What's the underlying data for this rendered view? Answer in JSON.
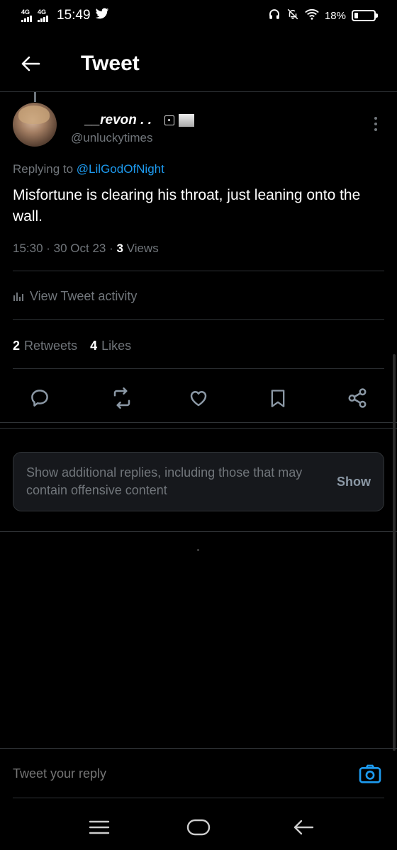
{
  "status_bar": {
    "network_1": "4G",
    "network_2": "4G",
    "time": "15:49",
    "battery_percent": "18%",
    "battery_level": 0.18,
    "icons": [
      "twitter-bird-icon",
      "headphones-icon",
      "mute-icon",
      "wifi-icon",
      "battery-icon"
    ]
  },
  "header": {
    "title": "Tweet",
    "back_icon": "arrow-left-icon"
  },
  "tweet": {
    "display_name": "__revon . .",
    "handle": "@unluckytimes",
    "replying_prefix": "Replying to",
    "replying_to": "@LilGodOfNight",
    "text": "Misfortune is clearing his throat, just leaning onto the wall.",
    "timestamp": "15:30 · 30 Oct 23 · ",
    "views_count": "3",
    "views_label": " Views",
    "activity_label": "View Tweet activity",
    "retweets_count": "2",
    "retweets_label": "Retweets",
    "likes_count": "4",
    "likes_label": "Likes"
  },
  "actions": [
    "reply-icon",
    "retweet-icon",
    "like-icon",
    "bookmark-icon",
    "share-icon"
  ],
  "hidden_replies": {
    "text": "Show additional replies, including those that may contain offensive content",
    "button": "Show"
  },
  "reply_bar": {
    "placeholder": "Tweet your reply"
  },
  "colors": {
    "background": "#000000",
    "accent": "#1d9bf0",
    "secondary_text": "#71767b",
    "divider": "#2f3336"
  }
}
